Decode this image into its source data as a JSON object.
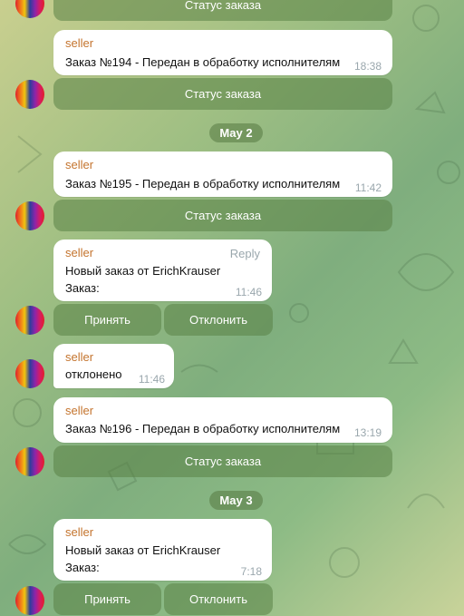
{
  "messages": {
    "m0": {
      "button": "Статус заказа"
    },
    "m1": {
      "sender": "seller",
      "text": "Заказ №194 - Передан в обработку исполнителям",
      "time": "18:38",
      "button": "Статус заказа"
    },
    "date1": "May 2",
    "m2": {
      "sender": "seller",
      "text": "Заказ №195 - Передан в обработку исполнителям",
      "time": "11:42",
      "button": "Статус заказа"
    },
    "m3": {
      "sender": "seller",
      "reply": "Reply",
      "line1": "Новый заказ от ErichKrauser",
      "line2": "Заказ:",
      "time": "11:46",
      "accept": "Принять",
      "decline": "Отклонить"
    },
    "m4": {
      "sender": "seller",
      "text": "отклонено",
      "time": "11:46"
    },
    "m5": {
      "sender": "seller",
      "text": "Заказ №196 - Передан в обработку исполнителям",
      "time": "13:19",
      "button": "Статус заказа"
    },
    "date2": "May 3",
    "m6": {
      "sender": "seller",
      "line1": "Новый заказ от ErichKrauser",
      "line2": "Заказ:",
      "time": "7:18",
      "accept": "Принять",
      "decline": "Отклонить"
    }
  }
}
